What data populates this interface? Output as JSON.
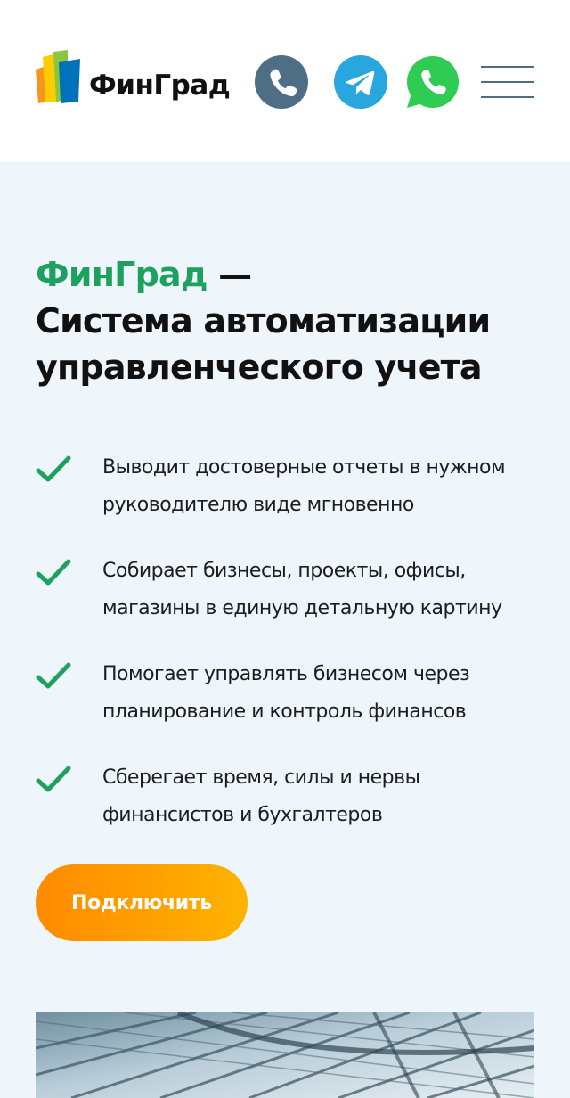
{
  "header": {
    "logo_text": "ФинГрад",
    "logo_colors": [
      "#f7941d",
      "#ffcc00",
      "#8cc63f",
      "#0072bc"
    ],
    "contacts": [
      {
        "name": "phone",
        "icon": "phone-icon",
        "color": "#4d6e85"
      },
      {
        "name": "telegram",
        "icon": "telegram-icon",
        "color": "#2aa6df"
      },
      {
        "name": "whatsapp",
        "icon": "whatsapp-icon",
        "color": "#2ecc52"
      }
    ],
    "menu_icon": "hamburger-menu-icon"
  },
  "hero": {
    "title_brand": "ФинГрад",
    "title_dash": " —",
    "title_rest": "Система автоматизации управленческого учета",
    "brand_color": "#1ea05e",
    "features": [
      {
        "icon": "checkmark-icon",
        "text": "Выводит достоверные отчеты в нужном руководителю виде мгновенно"
      },
      {
        "icon": "checkmark-icon",
        "text": "Собирает бизнесы, проекты, офисы, магазины в единую детальную картину"
      },
      {
        "icon": "checkmark-icon",
        "text": "Помогает управлять бизнесом через планирование и контроль финансов"
      },
      {
        "icon": "checkmark-icon",
        "text": "Сберегает время, силы и нервы финансистов и бухгалтеров"
      }
    ],
    "cta_label": "Подключить",
    "cta_gradient": [
      "#ff8a00",
      "#ffb300"
    ],
    "background_color": "#eef5fb"
  }
}
